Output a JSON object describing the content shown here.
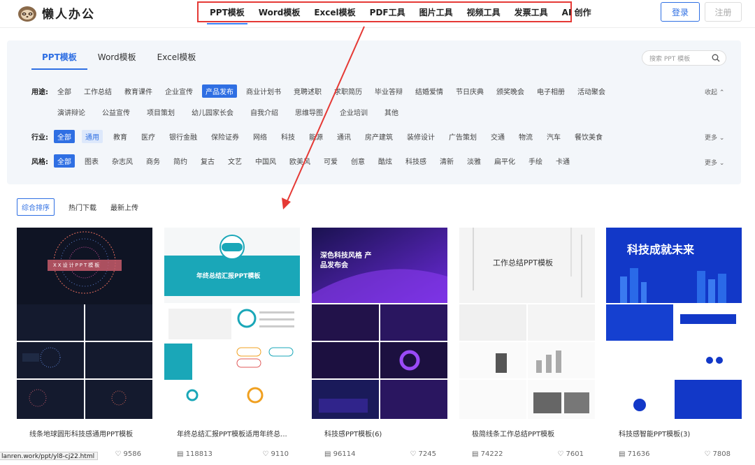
{
  "brand": {
    "name": "懒人办公",
    "logo_icon": "sloth-icon"
  },
  "topnav": [
    "PPT模板",
    "Word模板",
    "Excel模板",
    "PDF工具",
    "图片工具",
    "视频工具",
    "发票工具",
    "AI 创作"
  ],
  "auth": {
    "login": "登录",
    "register": "注册"
  },
  "tabs": [
    "PPT模板",
    "Word模板",
    "Excel模板"
  ],
  "search": {
    "placeholder": "搜索 PPT 模板"
  },
  "filters": {
    "usage": {
      "label": "用途:",
      "row1": [
        "全部",
        "工作总结",
        "教育课件",
        "企业宣传",
        "产品发布",
        "商业计划书",
        "竞聘述职",
        "求职简历",
        "毕业答辩",
        "结婚爱情",
        "节日庆典",
        "颁奖晚会",
        "电子相册",
        "活动聚会"
      ],
      "row2": [
        "演讲辩论",
        "公益宣传",
        "项目策划",
        "幼儿园家长会",
        "自我介绍",
        "思维导图",
        "企业培训",
        "其他"
      ],
      "selected": "产品发布",
      "toggle": "收起"
    },
    "industry": {
      "label": "行业:",
      "options": [
        "全部",
        "通用",
        "教育",
        "医疗",
        "银行金融",
        "保险证券",
        "网络",
        "科技",
        "能源",
        "通讯",
        "房产建筑",
        "装修设计",
        "广告策划",
        "交通",
        "物流",
        "汽车",
        "餐饮美食"
      ],
      "selected": "全部",
      "secondary": "通用",
      "more": "更多"
    },
    "style": {
      "label": "风格:",
      "options": [
        "全部",
        "图表",
        "杂志风",
        "商务",
        "简约",
        "复古",
        "文艺",
        "中国风",
        "欧美风",
        "可爱",
        "创意",
        "酷炫",
        "科技感",
        "清新",
        "淡雅",
        "扁平化",
        "手绘",
        "卡通"
      ],
      "selected": "全部",
      "more": "更多"
    }
  },
  "sort": [
    "综合排序",
    "热门下载",
    "最新上传"
  ],
  "cards": [
    {
      "title": "线条地球圆形科技感通用PPT模板",
      "downloads": "",
      "likes": "9586",
      "thumb_text": "XX设计PPT模板"
    },
    {
      "title": "年终总结汇报PPT模板适用年终总...",
      "downloads": "118813",
      "likes": "9110",
      "thumb_text": "年终总结汇报PPT模板"
    },
    {
      "title": "科技感PPT模板(6)",
      "downloads": "96114",
      "likes": "7245",
      "thumb_text": "深色科技风格 产品发布会"
    },
    {
      "title": "极简线条工作总结PPT模板",
      "downloads": "74222",
      "likes": "7601",
      "thumb_text": "工作总结PPT模板"
    },
    {
      "title": "科技感智能PPT模板(3)",
      "downloads": "71636",
      "likes": "7808",
      "thumb_text": "科技成就未来"
    }
  ],
  "status_url": "lanren.work/ppt/yl8-cj22.html",
  "colors": {
    "accent": "#2f6fe3",
    "annotation": "#e53935"
  }
}
